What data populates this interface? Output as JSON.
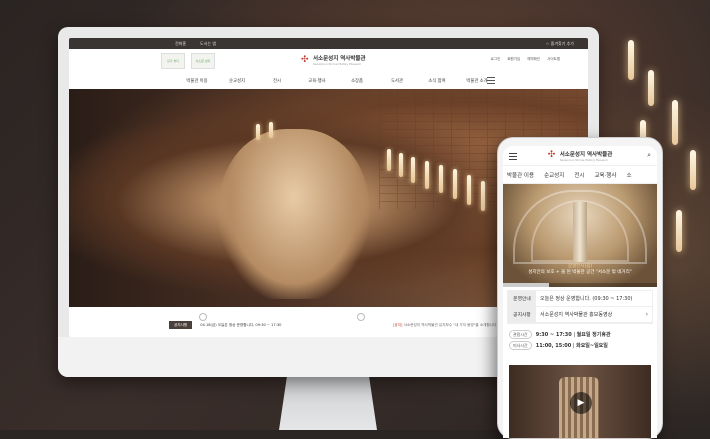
{
  "desktop": {
    "topbar": {
      "left_links": [
        "전화홈",
        "도서는 앱"
      ],
      "right_link": "☆ 즐겨찾기 추가"
    },
    "badges": [
      "강가 솔다",
      "서소문 성지"
    ],
    "brand": {
      "kr": "서소문성지 역사박물관",
      "en": "Seosomun Shrine History Museum"
    },
    "util_links": [
      "로그인",
      "회원가입",
      "예약확인",
      "사이트맵"
    ],
    "gnb": [
      "박물관 이용",
      "순교성지",
      "전시",
      "교육·행사",
      "소장품",
      "도서관",
      "소식 참여",
      "박물관 소개"
    ],
    "notice": {
      "tag": "공지사항",
      "text": "04.18(금)  오늘은 정상 운영합니다.  09:30 ~ 17:30",
      "text2_prefix": "[공지]",
      "text2": "서소문성지 역사박물관 유지보수 \"내 가지 봉양\"을 소개합니다"
    }
  },
  "mobile": {
    "brand": {
      "kr": "서소문성지 역사박물관",
      "en": "Seosomun Shrine History Museum"
    },
    "nav": [
      "박물관 이용",
      "순교성지",
      "전시",
      "교육·행사",
      "소"
    ],
    "hero": {
      "caption1": "상설전시(음)",
      "caption2": "성지안의 보호 + 을 된 박물관 공간 \"서소문 밖 네거리\""
    },
    "info_rows": [
      {
        "label": "운영안내",
        "text": "오늘은 정상 운영합니다. (09:30 ~ 17:30)"
      },
      {
        "label": "공지사항",
        "text": "서소문성지 역사박물관 홍보동영상"
      }
    ],
    "hours": [
      {
        "label": "관람시간",
        "time": "9:30 ~ 17:30",
        "note": "월요일 정기휴관"
      },
      {
        "label": "미사시간",
        "time": "11:00, 15:00",
        "note": "화요일~일요일"
      }
    ]
  }
}
